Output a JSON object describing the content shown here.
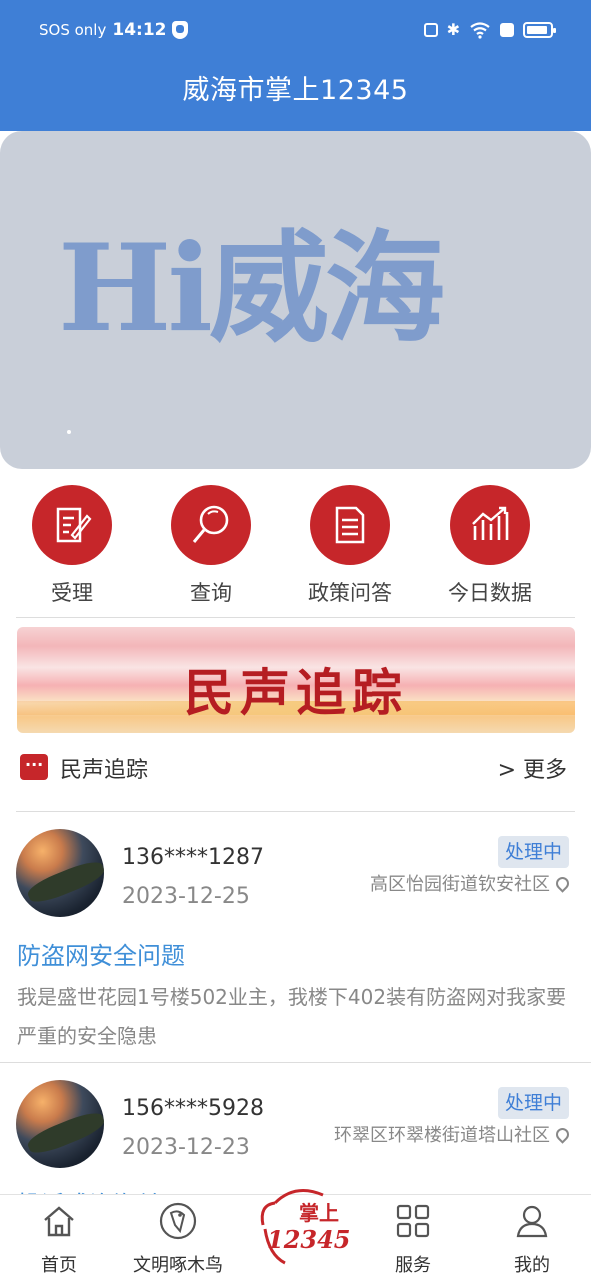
{
  "status_bar": {
    "carrier": "SOS only",
    "time": "14:12"
  },
  "app": {
    "title": "威海市掌上12345"
  },
  "banner": {
    "text": "Hi威海"
  },
  "quick_actions": [
    {
      "label": "受理",
      "icon": "edit-document-icon"
    },
    {
      "label": "查询",
      "icon": "search-icon"
    },
    {
      "label": "政策问答",
      "icon": "document-list-icon"
    },
    {
      "label": "今日数据",
      "icon": "chart-trend-icon"
    }
  ],
  "section": {
    "banner_text": "民声追踪",
    "title": "民声追踪",
    "more": "> 更多"
  },
  "cards": [
    {
      "phone": "136****1287",
      "date": "2023-12-25",
      "status": "处理中",
      "location": "高区怡园街道钦安社区",
      "title": "防盗网安全问题",
      "body": "我是盛世花园1号楼502业主，我楼下402装有防盗网对我家要严重的安全隐患"
    },
    {
      "phone": "156****5928",
      "date": "2023-12-23",
      "status": "处理中",
      "location": "环翠区环翠楼街道塔山社区",
      "title": "投诉或询海关"
    }
  ],
  "bottom_nav": {
    "home": "首页",
    "woodpecker": "文明啄木鸟",
    "center_logo_top": "掌上",
    "center_logo_bottom": "12345",
    "services": "服务",
    "mine": "我的"
  },
  "colors": {
    "header": "#3f7fd6",
    "accent_red": "#c6262a",
    "link_blue": "#3f8fd8"
  }
}
